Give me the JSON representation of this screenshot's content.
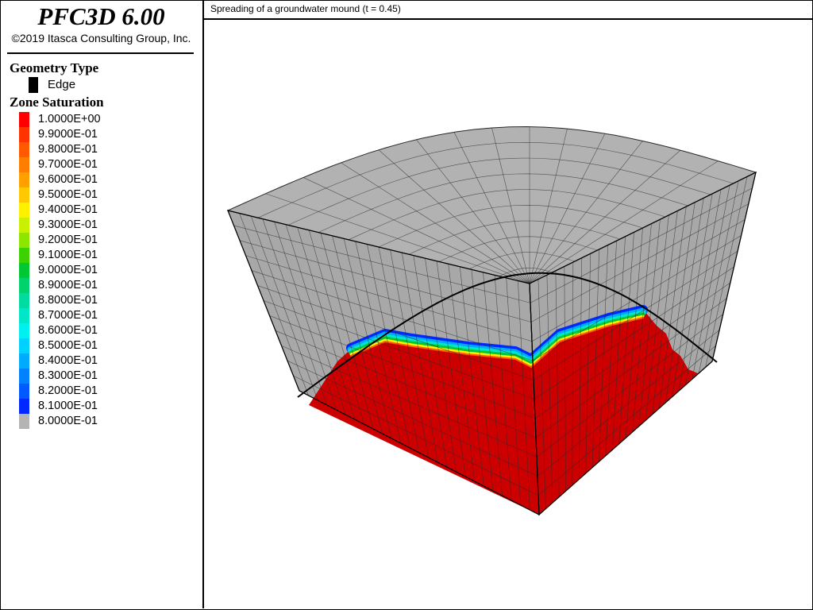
{
  "app": {
    "name": "PFC3D 6.00",
    "copyright": "©2019 Itasca Consulting Group, Inc."
  },
  "legend": {
    "geometry_title": "Geometry Type",
    "geometry_items": [
      {
        "label": "Edge",
        "color": "#000000"
      }
    ],
    "zone_title": "Zone Saturation",
    "zone_items": [
      {
        "label": "1.0000E+00",
        "color": "#ff0000"
      },
      {
        "label": "9.9000E-01",
        "color": "#ff3300"
      },
      {
        "label": "9.8000E-01",
        "color": "#ff5a00"
      },
      {
        "label": "9.7000E-01",
        "color": "#ff7e00"
      },
      {
        "label": "9.6000E-01",
        "color": "#ffa000"
      },
      {
        "label": "9.5000E-01",
        "color": "#ffc800"
      },
      {
        "label": "9.4000E-01",
        "color": "#fff000"
      },
      {
        "label": "9.3000E-01",
        "color": "#c8f000"
      },
      {
        "label": "9.2000E-01",
        "color": "#8ce600"
      },
      {
        "label": "9.1000E-01",
        "color": "#3cd200"
      },
      {
        "label": "9.0000E-01",
        "color": "#00c832"
      },
      {
        "label": "8.9000E-01",
        "color": "#00d26e"
      },
      {
        "label": "8.8000E-01",
        "color": "#00dca0"
      },
      {
        "label": "8.7000E-01",
        "color": "#00e6c8"
      },
      {
        "label": "8.6000E-01",
        "color": "#00f0f0"
      },
      {
        "label": "8.5000E-01",
        "color": "#00d2ff"
      },
      {
        "label": "8.4000E-01",
        "color": "#00aaff"
      },
      {
        "label": "8.3000E-01",
        "color": "#0082ff"
      },
      {
        "label": "8.2000E-01",
        "color": "#005aff"
      },
      {
        "label": "8.1000E-01",
        "color": "#0028ff"
      },
      {
        "label": "8.0000E-01",
        "color": "#b4b4b4"
      }
    ]
  },
  "plot": {
    "title": "Spreading of a groundwater mound (t = 0.45)",
    "colors": {
      "unsaturated": "#a8a8a8",
      "saturated": "#cc0000",
      "edge": "#000000",
      "grid": "#2a2a2a"
    }
  }
}
